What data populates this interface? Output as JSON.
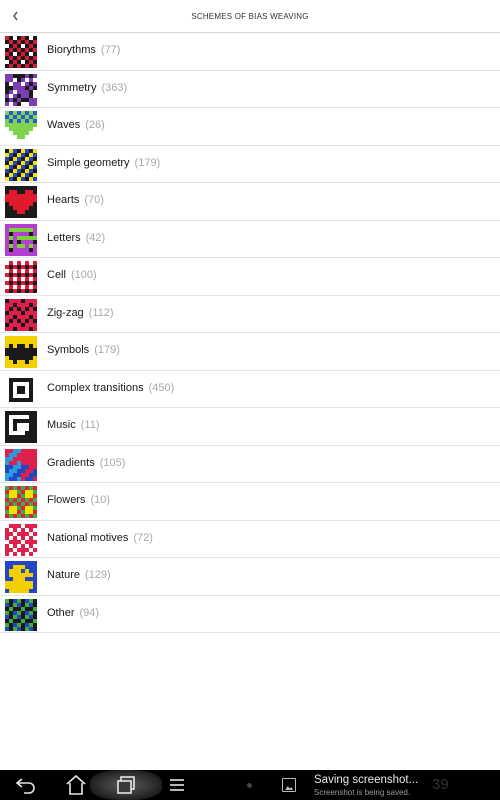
{
  "header": {
    "title": "SCHEMES OF BIAS WEAVING",
    "back_icon": "chevron-left-icon"
  },
  "categories": [
    {
      "name": "Biorythms",
      "count": "(77)",
      "colors": [
        "#d81b3c",
        "#1a1a1a",
        "#ffffff"
      ],
      "icon": "biorythms-pattern-icon"
    },
    {
      "name": "Symmetry",
      "count": "(363)",
      "colors": [
        "#7b3fb3",
        "#1a1a1a",
        "#ffffff"
      ],
      "icon": "symmetry-pattern-icon"
    },
    {
      "name": "Waves",
      "count": "(26)",
      "colors": [
        "#2a5bd7",
        "#7fd34e",
        "#ffffff"
      ],
      "icon": "waves-pattern-icon"
    },
    {
      "name": "Simple geometry",
      "count": "(179)",
      "colors": [
        "#f2e300",
        "#2346c8",
        "#1a1a1a"
      ],
      "icon": "geometry-pattern-icon"
    },
    {
      "name": "Hearts",
      "count": "(70)",
      "colors": [
        "#e0192c",
        "#1a1a1a",
        "#1a1a1a"
      ],
      "icon": "hearts-pattern-icon"
    },
    {
      "name": "Letters",
      "count": "(42)",
      "colors": [
        "#b33fd0",
        "#7bd23a",
        "#1a1a1a"
      ],
      "icon": "letters-pattern-icon"
    },
    {
      "name": "Cell",
      "count": "(100)",
      "colors": [
        "#d81b3c",
        "#ffffff",
        "#1a1a1a"
      ],
      "icon": "cell-pattern-icon"
    },
    {
      "name": "Zig-zag",
      "count": "(112)",
      "colors": [
        "#e0204a",
        "#1a1a1a",
        "#7a1030"
      ],
      "icon": "zigzag-pattern-icon"
    },
    {
      "name": "Symbols",
      "count": "(179)",
      "colors": [
        "#f4d000",
        "#1a1a1a",
        "#1a1a1a"
      ],
      "icon": "symbols-pattern-icon"
    },
    {
      "name": "Complex transitions",
      "count": "(450)",
      "colors": [
        "#ffffff",
        "#1a1a1a",
        "#888888"
      ],
      "icon": "transitions-pattern-icon"
    },
    {
      "name": "Music",
      "count": "(11)",
      "colors": [
        "#ffffff",
        "#1a1a1a",
        "#555555"
      ],
      "icon": "music-pattern-icon"
    },
    {
      "name": "Gradients",
      "count": "(105)",
      "colors": [
        "#e0204a",
        "#1f48c8",
        "#2b9be0"
      ],
      "icon": "gradients-pattern-icon"
    },
    {
      "name": "Flowers",
      "count": "(10)",
      "colors": [
        "#e0204a",
        "#f2e300",
        "#3fae3a"
      ],
      "icon": "flowers-pattern-icon"
    },
    {
      "name": "National motives",
      "count": "(72)",
      "colors": [
        "#e0204a",
        "#ffffff",
        "#b01030"
      ],
      "icon": "national-pattern-icon"
    },
    {
      "name": "Nature",
      "count": "(129)",
      "colors": [
        "#2346c8",
        "#f2d000",
        "#1a1a1a"
      ],
      "icon": "nature-pattern-icon"
    },
    {
      "name": "Other",
      "count": "(94)",
      "colors": [
        "#3fae3a",
        "#2346c8",
        "#1a1a1a"
      ],
      "icon": "other-pattern-icon"
    }
  ],
  "navbar": {
    "back_icon": "back-arrow-icon",
    "home_icon": "home-icon",
    "recent_icon": "recent-apps-icon",
    "menu_icon": "menu-icon",
    "notification_title": "Saving screenshot...",
    "notification_subtitle": "Screenshot is being saved.",
    "clock": "39"
  },
  "colors": {
    "divider": "#e3e3e3",
    "count_text": "#a8a8a8",
    "navbar_bg": "#000000"
  }
}
